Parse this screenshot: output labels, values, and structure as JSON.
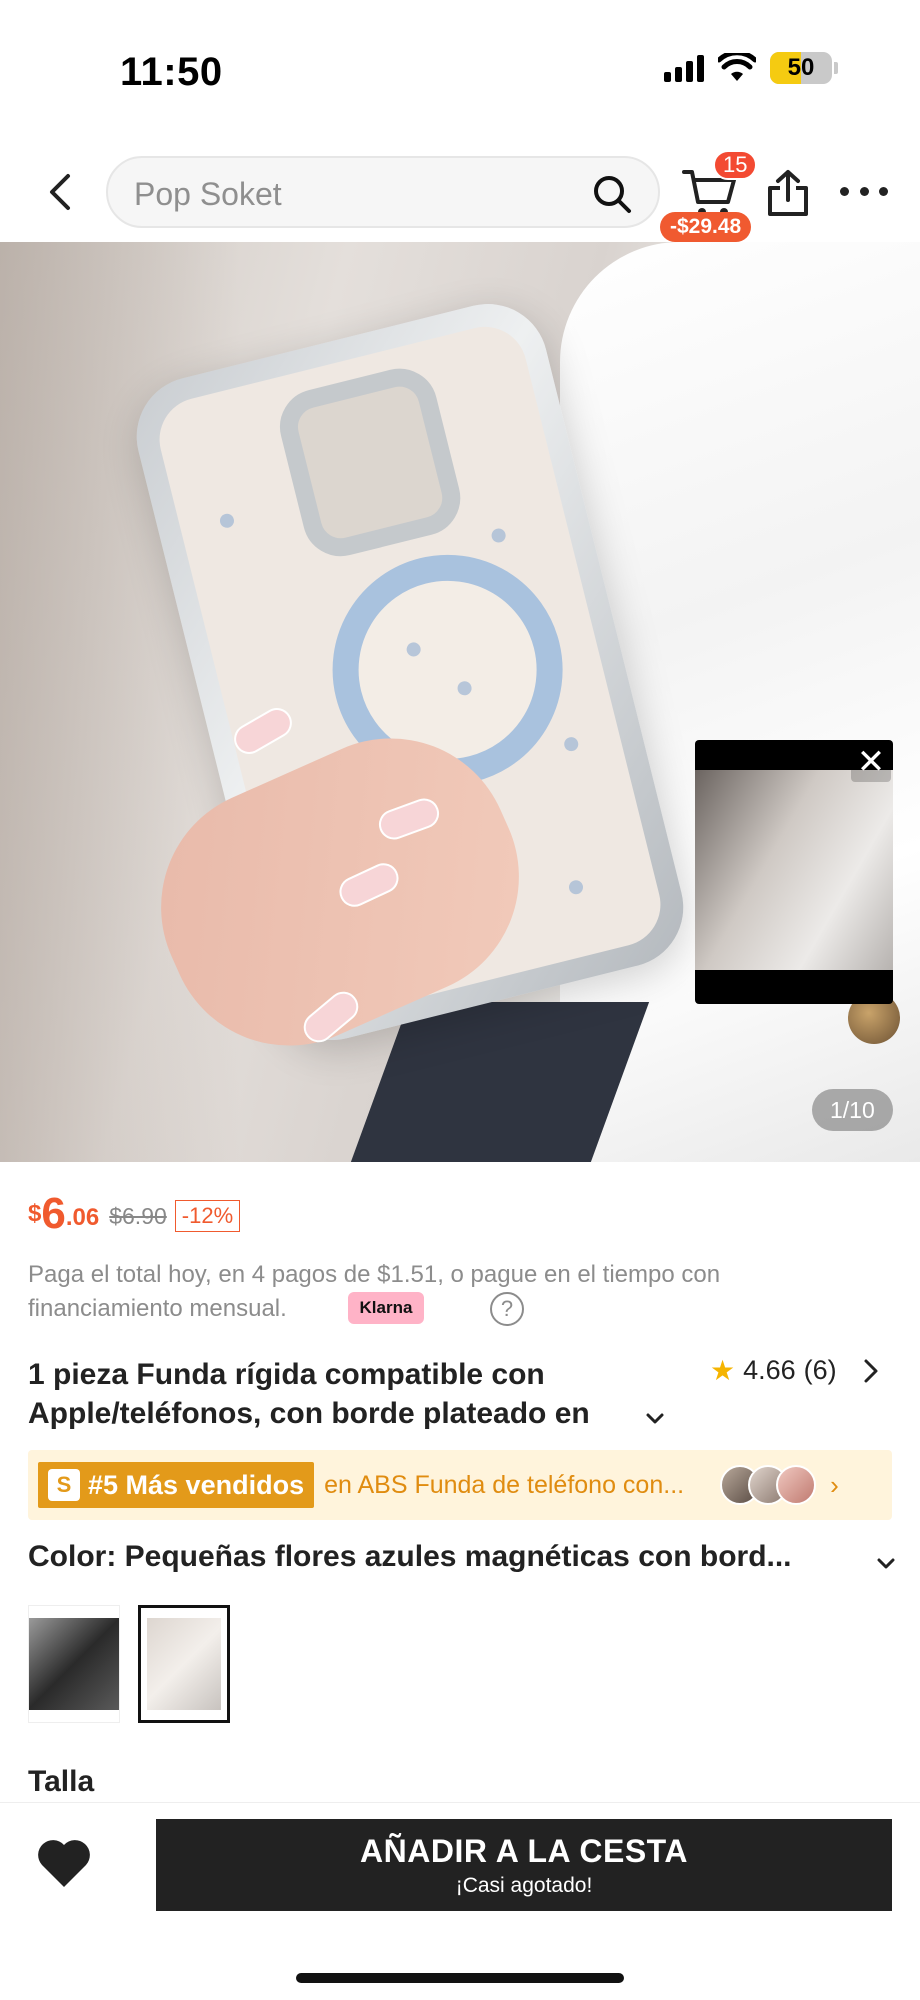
{
  "status_bar": {
    "time": "11:50",
    "battery": "50",
    "battery_level": 0.5
  },
  "header": {
    "search_placeholder": "Pop Soket",
    "cart_count": "15",
    "cart_total": "-$29.48"
  },
  "gallery": {
    "counter": "1/10",
    "mini_player_close": "✕"
  },
  "price": {
    "currency": "$",
    "integer": "6",
    "decimal": ".06",
    "original": "$6.90",
    "discount": "-12%"
  },
  "payment": {
    "text": "Paga el total hoy, en 4 pagos de $1.51, o pague en el tiempo con financiamiento mensual.",
    "klarna_label": "Klarna",
    "help": "?"
  },
  "product": {
    "title": "1 pieza Funda rígida compatible con Apple/teléfonos, con borde plateado en",
    "rating": "4.66",
    "review_count": "(6)"
  },
  "bestseller": {
    "tag": "#5 Más vendidos",
    "text": "en ABS Funda de teléfono con...",
    "icon_letter": "S"
  },
  "color": {
    "label": "Color: Pequeñas flores azules magnéticas con bord...",
    "swatches": [
      "black-glitter-case",
      "blue-flowers-magnetic-case"
    ],
    "selected_index": 1
  },
  "size": {
    "label": "Talla"
  },
  "bottom": {
    "add_to_cart": "AÑADIR A LA CESTA",
    "stock_note": "¡Casi agotado!"
  },
  "colors": {
    "accent": "#f05a2e",
    "bestseller_bg": "#fff4dc",
    "bestseller_tag": "#e39a1a",
    "button_bg": "#222222"
  }
}
